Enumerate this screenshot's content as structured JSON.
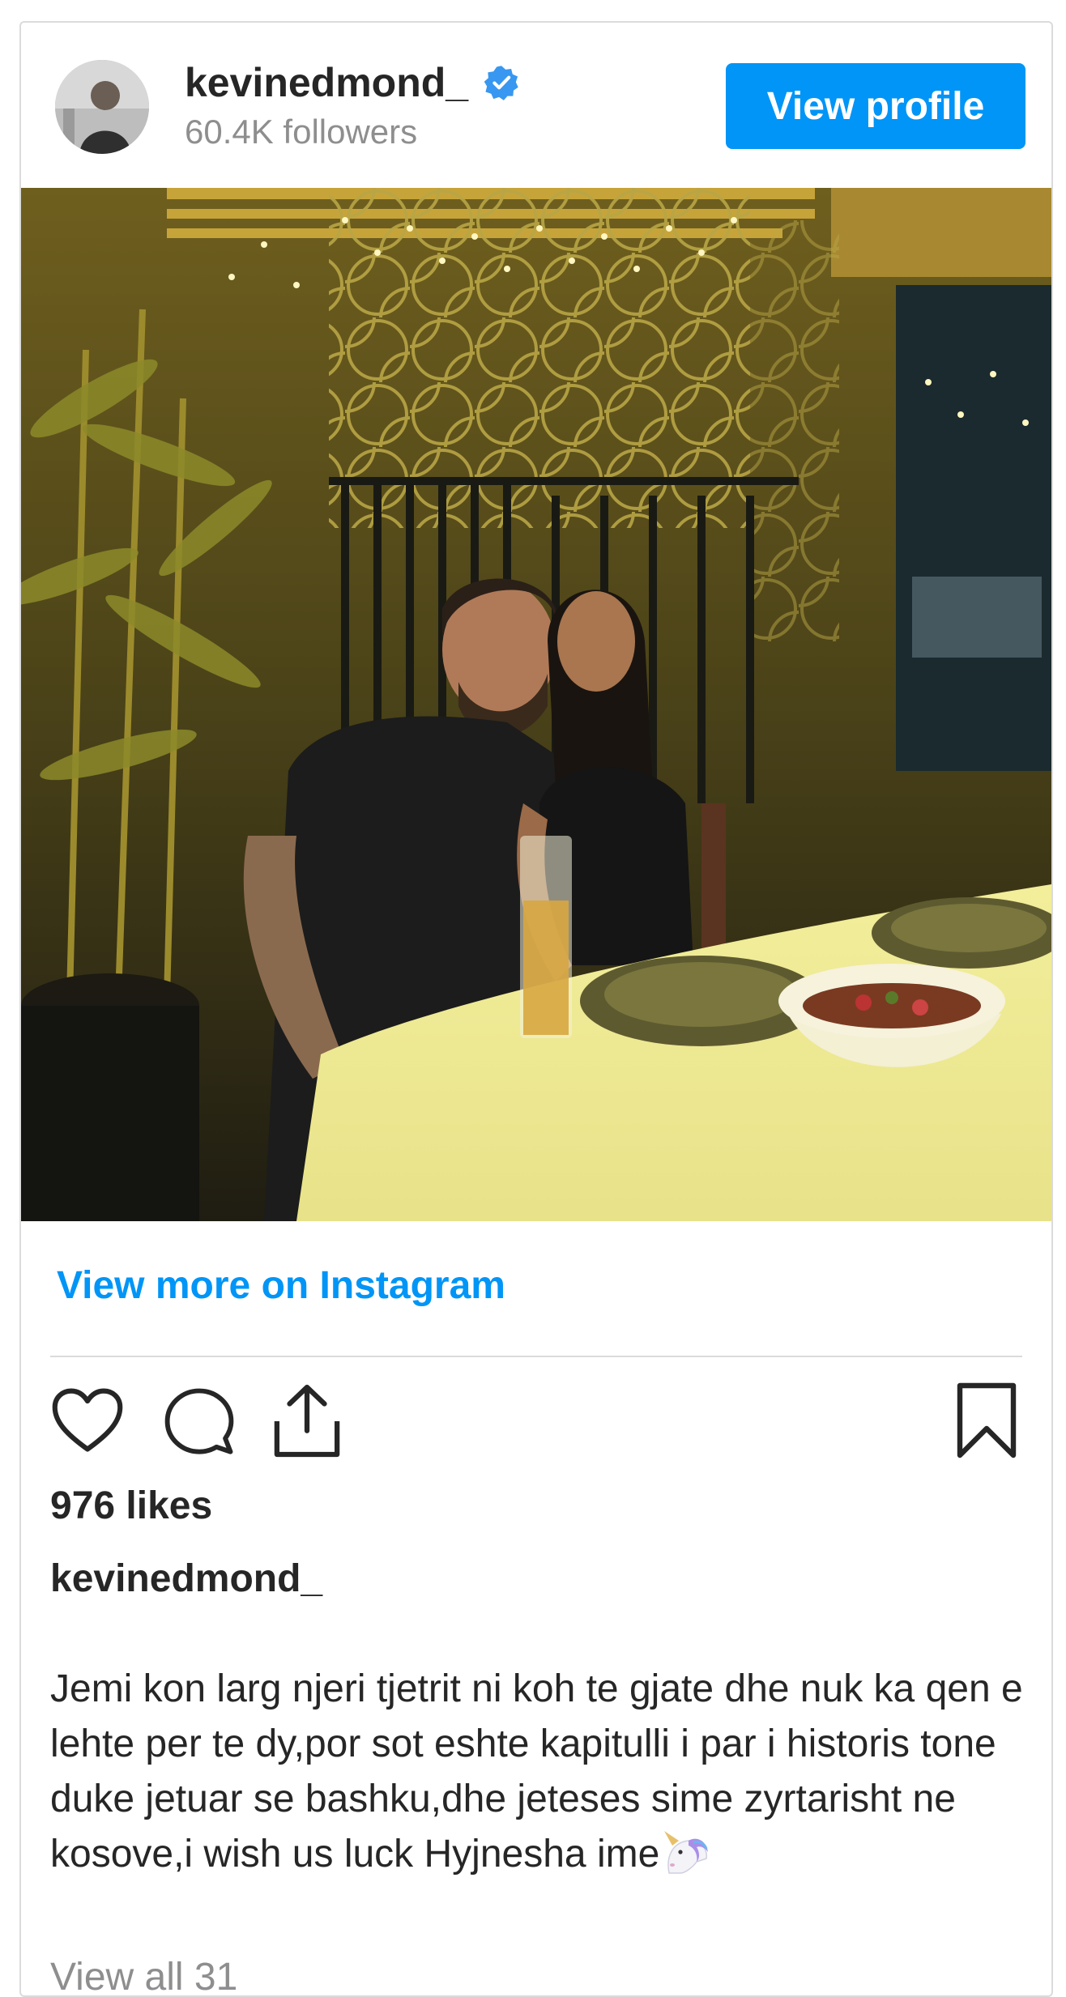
{
  "header": {
    "username": "kevinedmond_",
    "followers": "60.4K followers",
    "view_profile_label": "View profile",
    "verified_icon": "verified-badge-icon",
    "verified_color": "#3897f0"
  },
  "post": {
    "photo_alt": "Two people seated at a restaurant table with beer, plates and a salad bowl under warm string lights",
    "view_more_label": "View more on Instagram",
    "likes": "976 likes",
    "caption_user": "kevinedmond_",
    "caption_text": "Jemi kon larg njeri tjetrit ni koh te gjate dhe nuk ka qen e lehte per te dy,por sot eshte kapitulli i par i historis tone duke jetuar se bashku,dhe jeteses sime zyrtarisht ne kosove,i wish us luck Hyjnesha ime",
    "caption_emoji": "unicorn-emoji-icon",
    "view_all_comments": "View all 31"
  },
  "actions": {
    "like_icon": "heart-icon",
    "comment_icon": "comment-icon",
    "share_icon": "share-icon",
    "save_icon": "bookmark-icon"
  },
  "colors": {
    "accent": "#0095f6",
    "text": "#262626",
    "muted": "#8e8e8e",
    "border": "#dbdbdb"
  }
}
